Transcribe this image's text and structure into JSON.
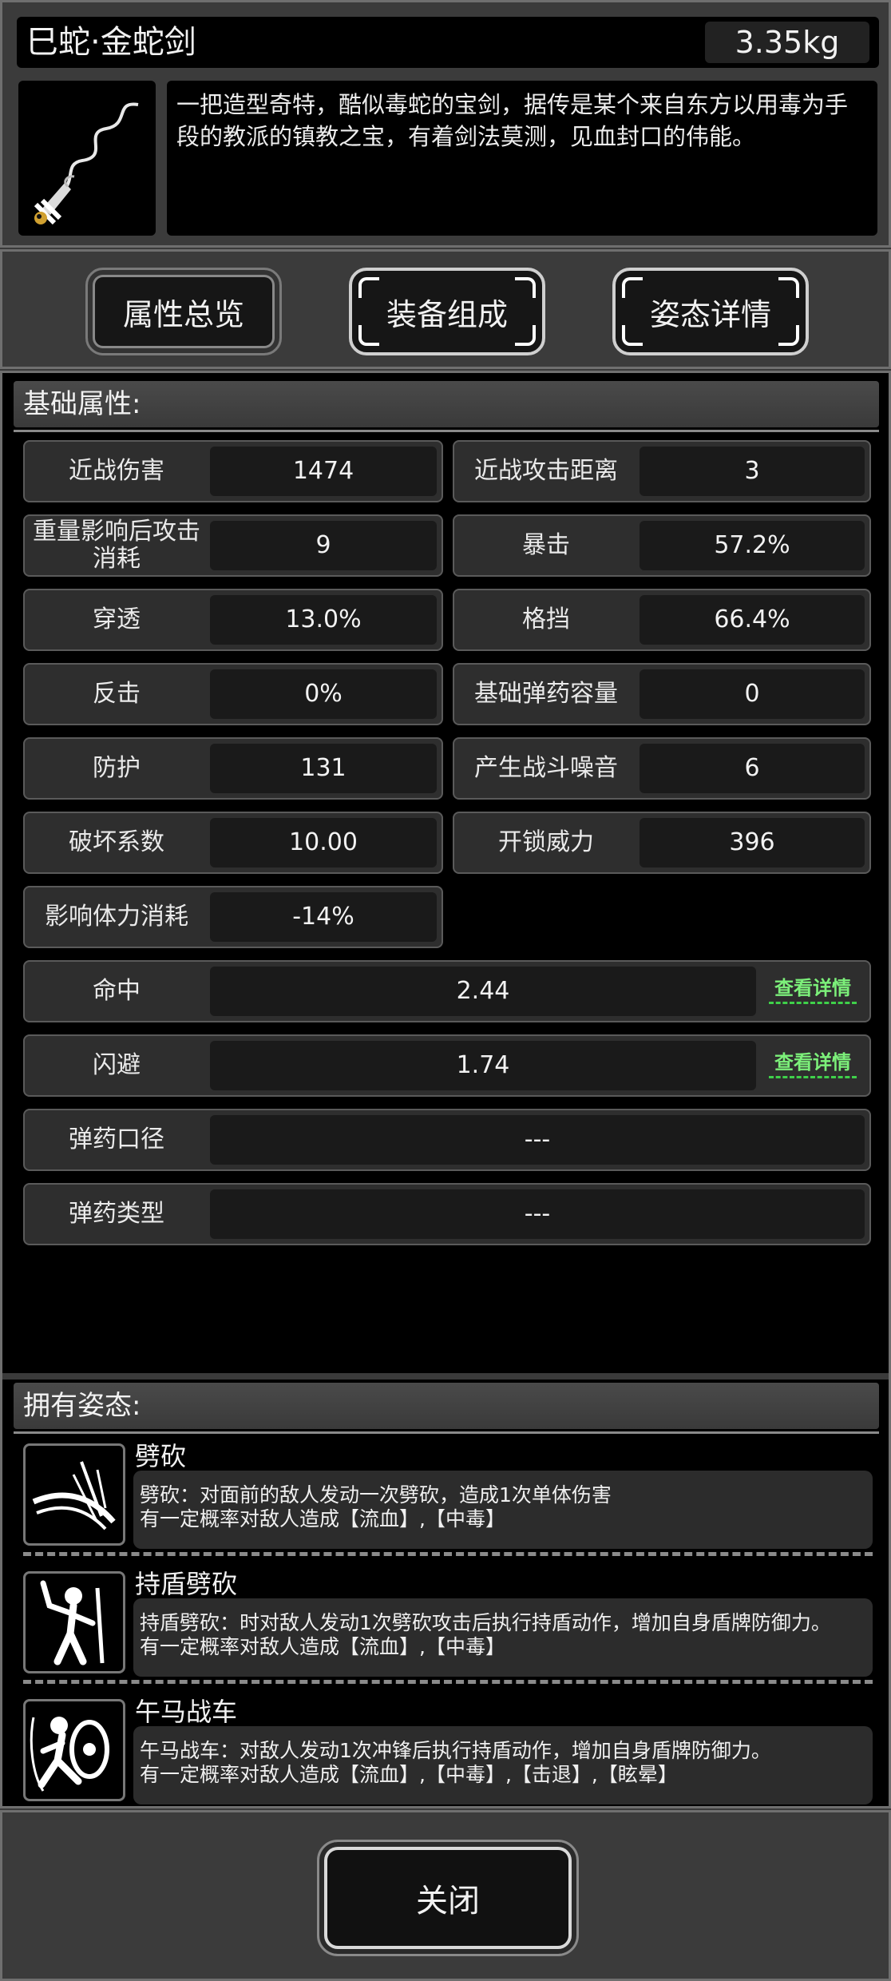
{
  "header": {
    "title": "巳蛇·金蛇剑",
    "weight": "3.35kg",
    "item_icon": "golden-snake-sword-icon",
    "description": "一把造型奇特，酷似毒蛇的宝剑，据传是某个来自东方以用毒为手段的教派的镇教之宝，有着剑法莫测，见血封口的伟能。"
  },
  "tabs": [
    {
      "label": "属性总览",
      "active": true
    },
    {
      "label": "装备组成",
      "active": false
    },
    {
      "label": "姿态详情",
      "active": false
    }
  ],
  "basic": {
    "heading": "基础属性:",
    "stats": [
      {
        "label": "近战伤害",
        "value": "1474"
      },
      {
        "label": "近战攻击距离",
        "value": "3"
      },
      {
        "label": "重量影响后攻击消耗",
        "value": "9"
      },
      {
        "label": "暴击",
        "value": "57.2%"
      },
      {
        "label": "穿透",
        "value": "13.0%"
      },
      {
        "label": "格挡",
        "value": "66.4%"
      },
      {
        "label": "反击",
        "value": "0%"
      },
      {
        "label": "基础弹药容量",
        "value": "0"
      },
      {
        "label": "防护",
        "value": "131"
      },
      {
        "label": "产生战斗噪音",
        "value": "6"
      },
      {
        "label": "破坏系数",
        "value": "10.00"
      },
      {
        "label": "开锁威力",
        "value": "396"
      },
      {
        "label": "影响体力消耗",
        "value": "-14%"
      }
    ],
    "wide_stats": [
      {
        "label": "命中",
        "value": "2.44",
        "link": "查看详情"
      },
      {
        "label": "闪避",
        "value": "1.74",
        "link": "查看详情"
      },
      {
        "label": "弹药口径",
        "value": "---"
      },
      {
        "label": "弹药类型",
        "value": "---"
      }
    ]
  },
  "stances": {
    "heading": "拥有姿态:",
    "items": [
      {
        "name": "劈砍",
        "icon": "slash-icon",
        "desc1": "劈砍：对面前的敌人发动一次劈砍，造成1次单体伤害",
        "desc2": "有一定概率对敌人造成【流血】,【中毒】"
      },
      {
        "name": "持盾劈砍",
        "icon": "shield-slash-icon",
        "desc1": "持盾劈砍：时对敌人发动1次劈砍攻击后执行持盾动作，增加自身盾牌防御力。",
        "desc2": "有一定概率对敌人造成【流血】,【中毒】"
      },
      {
        "name": "午马战车",
        "icon": "shield-charge-icon",
        "desc1": "午马战车：对敌人发动1次冲锋后执行持盾动作，增加自身盾牌防御力。",
        "desc2": "有一定概率对敌人造成【流血】,【中毒】,【击退】,【眩晕】"
      }
    ]
  },
  "footer": {
    "close_label": "关闭"
  },
  "colors": {
    "link_green": "#7cf07a",
    "panel_border": "#6f6f6f"
  }
}
